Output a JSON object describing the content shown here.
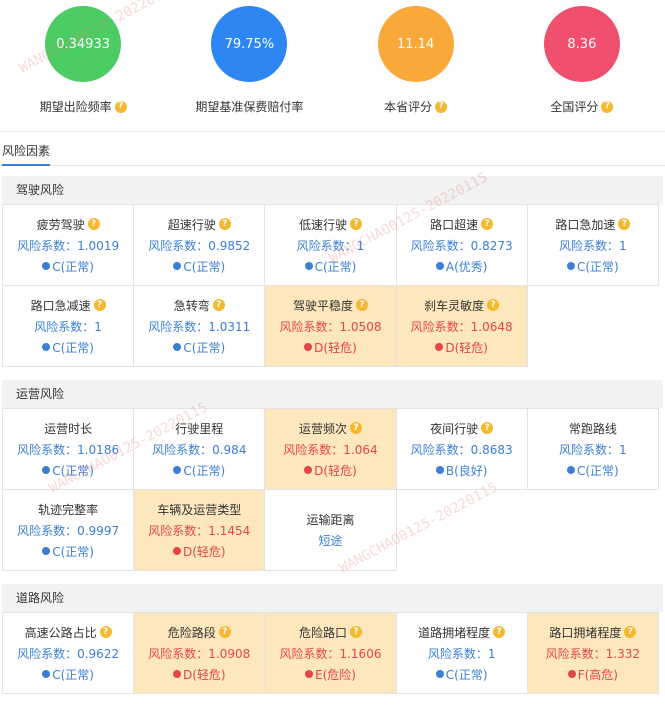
{
  "metrics": [
    {
      "value": "0.34933",
      "label": "期望出险频率",
      "color": "#4ccd64"
    },
    {
      "value": "79.75%",
      "label": "期望基准保费赔付率",
      "color": "#2e86f2"
    },
    {
      "value": "11.14",
      "label": "本省评分",
      "color": "#f9a83a"
    },
    {
      "value": "8.36",
      "label": "全国评分",
      "color": "#f0506e"
    }
  ],
  "tab": "风险因素",
  "help_icon": "?",
  "watermark": "WANGCHAO0125-20220115",
  "sections": [
    {
      "title": "驾驶风险",
      "rows": [
        [
          {
            "title": "疲劳驾驶",
            "help": true,
            "coef": "风险系数：1.0019",
            "level": "C(正常)",
            "warn": false
          },
          {
            "title": "超速行驶",
            "help": true,
            "coef": "风险系数：0.9852",
            "level": "C(正常)",
            "warn": false
          },
          {
            "title": "低速行驶",
            "help": true,
            "coef": "风险系数：1",
            "level": "C(正常)",
            "warn": false
          },
          {
            "title": "路口超速",
            "help": true,
            "coef": "风险系数：0.8273",
            "level": "A(优秀)",
            "warn": false
          },
          {
            "title": "路口急加速",
            "help": true,
            "coef": "风险系数：1",
            "level": "C(正常)",
            "warn": false
          }
        ],
        [
          {
            "title": "路口急减速",
            "help": true,
            "coef": "风险系数：1",
            "level": "C(正常)",
            "warn": false
          },
          {
            "title": "急转弯",
            "help": true,
            "coef": "风险系数：1.0311",
            "level": "C(正常)",
            "warn": false
          },
          {
            "title": "驾驶平稳度",
            "help": true,
            "coef": "风险系数：1.0508",
            "level": "D(轻危)",
            "warn": true
          },
          {
            "title": "刹车灵敏度",
            "help": true,
            "coef": "风险系数：1.0648",
            "level": "D(轻危)",
            "warn": true
          }
        ]
      ]
    },
    {
      "title": "运营风险",
      "rows": [
        [
          {
            "title": "运营时长",
            "help": false,
            "coef": "风险系数：1.0186",
            "level": "C(正常)",
            "warn": false
          },
          {
            "title": "行驶里程",
            "help": false,
            "coef": "风险系数：0.984",
            "level": "C(正常)",
            "warn": false
          },
          {
            "title": "运营频次",
            "help": true,
            "coef": "风险系数：1.064",
            "level": "D(轻危)",
            "warn": true
          },
          {
            "title": "夜间行驶",
            "help": true,
            "coef": "风险系数：0.8683",
            "level": "B(良好)",
            "warn": false
          },
          {
            "title": "常跑路线",
            "help": false,
            "coef": "风险系数：1",
            "level": "C(正常)",
            "warn": false
          }
        ],
        [
          {
            "title": "轨迹完整率",
            "help": false,
            "coef": "风险系数：0.9997",
            "level": "C(正常)",
            "warn": false
          },
          {
            "title": "车辆及运营类型",
            "help": false,
            "coef": "风险系数：1.1454",
            "level": "D(轻危)",
            "warn": true
          },
          {
            "title": "运输距离",
            "help": false,
            "coef": "短途",
            "level": "",
            "warn": false
          }
        ]
      ]
    },
    {
      "title": "道路风险",
      "rows": [
        [
          {
            "title": "高速公路占比",
            "help": true,
            "coef": "风险系数：0.9622",
            "level": "C(正常)",
            "warn": false
          },
          {
            "title": "危险路段",
            "help": true,
            "coef": "风险系数：1.0908",
            "level": "D(轻危)",
            "warn": true
          },
          {
            "title": "危险路口",
            "help": true,
            "coef": "风险系数：1.1606",
            "level": "E(危险)",
            "warn": true
          },
          {
            "title": "道路拥堵程度",
            "help": true,
            "coef": "风险系数：1",
            "level": "C(正常)",
            "warn": false
          },
          {
            "title": "路口拥堵程度",
            "help": true,
            "coef": "风险系数：1.332",
            "level": "F(高危)",
            "warn": true
          }
        ]
      ]
    }
  ]
}
